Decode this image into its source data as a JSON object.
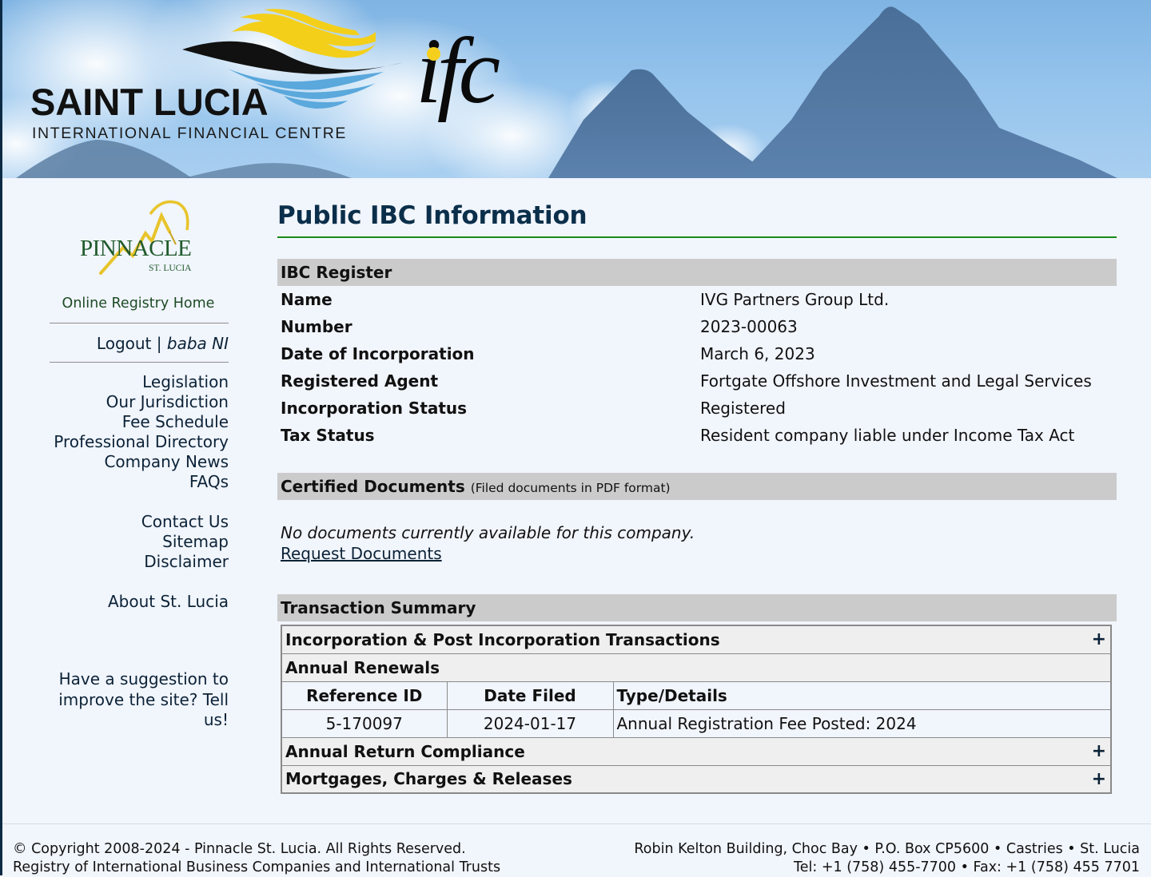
{
  "banner": {
    "brand_main": "SAINT LUCIA",
    "brand_sub": "INTERNATIONAL FINANCIAL CENTRE",
    "brand_mark": "ifc"
  },
  "sidebar": {
    "logo_word": "PINNACLE",
    "logo_sub": "ST. LUCIA",
    "registry_home": "Online Registry Home",
    "logout": "Logout",
    "separator": "|",
    "user": "baba NI",
    "nav_primary": [
      "Legislation",
      "Our Jurisdiction",
      "Fee Schedule",
      "Professional Directory",
      "Company News",
      "FAQs"
    ],
    "nav_secondary": [
      "Contact Us",
      "Sitemap",
      "Disclaimer"
    ],
    "nav_tertiary": [
      "About St. Lucia"
    ],
    "suggestion_line1": "Have a suggestion to",
    "suggestion_line2": "improve the site? Tell us!"
  },
  "main": {
    "title": "Public IBC Information",
    "register": {
      "heading": "IBC Register",
      "rows": [
        {
          "label": "Name",
          "value": "IVG Partners Group Ltd."
        },
        {
          "label": "Number",
          "value": "2023-00063"
        },
        {
          "label": "Date of Incorporation",
          "value": "March 6, 2023"
        },
        {
          "label": "Registered Agent",
          "value": "Fortgate Offshore Investment and Legal Services"
        },
        {
          "label": "Incorporation Status",
          "value": "Registered"
        },
        {
          "label": "Tax Status",
          "value": "Resident company liable under Income Tax Act"
        }
      ]
    },
    "documents": {
      "heading": "Certified Documents",
      "heading_note": "(Filed documents in PDF format)",
      "empty_message": "No documents currently available for this company.",
      "request_link": "Request Documents"
    },
    "transactions": {
      "heading": "Transaction Summary",
      "groups": {
        "incorporation": "Incorporation & Post Incorporation Transactions",
        "renewals": "Annual Renewals",
        "compliance": "Annual Return Compliance",
        "mortgages": "Mortgages, Charges & Releases"
      },
      "expand_symbol": "+",
      "columns": [
        "Reference ID",
        "Date Filed",
        "Type/Details"
      ],
      "renewal_rows": [
        {
          "ref": "5-170097",
          "date": "2024-01-17",
          "details": "Annual Registration Fee Posted: 2024"
        }
      ]
    }
  },
  "footer": {
    "copyright": "© Copyright 2008-2024 - Pinnacle St. Lucia. All Rights Reserved.",
    "registry": "Registry of International Business Companies and International Trusts",
    "address": "Robin Kelton Building, Choc Bay • P.O. Box CP5600 • Castries • St. Lucia",
    "phone": "Tel: +1 (758) 455-7700 • Fax: +1 (758) 455 7701"
  },
  "colors": {
    "background": "#f1f5fc",
    "section_header": "#cbcbcb",
    "title_rule": "#1a8a1a",
    "navy": "#0b2237"
  }
}
